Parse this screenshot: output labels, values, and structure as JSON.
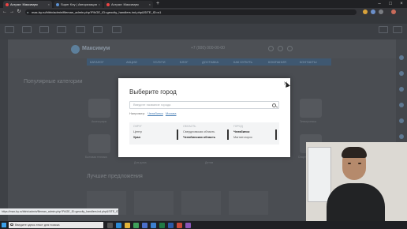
{
  "browser": {
    "tabs": [
      {
        "label": "Астрал: Максимум"
      },
      {
        "label": "Super Key | Авторизация"
      },
      {
        "label": "Астрал: Максимум"
      }
    ],
    "url": "max-by.ru/bitrix/admin/fileman_admin.php?PAGE_ID=geocity_handlers.ind.php&SITE_ID=s1",
    "status_url": "https://max-by.ru/bitrix/admin/fileman_admin.php?PAGE_ID=geocity_handlers.ind.php&SITE_ID=s1#"
  },
  "site": {
    "logo_text": "Максимум",
    "phone": "+7 (000) 000-00-00",
    "menu": [
      "КАТАЛОГ",
      "АКЦИИ",
      "УСЛУГИ",
      "БЛОГ",
      "ДОСТАВКА",
      "КАК КУПИТЬ",
      "КОМПАНИЯ",
      "КОНТАКТЫ"
    ],
    "section_popular": "Популярные категории",
    "section_best": "Лучшие предложения",
    "tiles": [
      "Аксессуары",
      "Электроника",
      "Бытовая техника",
      "Спорт и отдых",
      "Для дома",
      "Детям"
    ]
  },
  "modal": {
    "title": "Выберите город",
    "search_placeholder": "Введите название города",
    "examples_label": "Например:",
    "examples": [
      "Челябинск",
      "Москва"
    ],
    "columns": {
      "region": {
        "header": "ОКРУГ",
        "items": [
          "Центр",
          "Урал"
        ]
      },
      "area": {
        "header": "ОБЛАСТЬ",
        "items": [
          "Свердловская область",
          "Челябинская область"
        ]
      },
      "city": {
        "header": "ГОРОД",
        "items": [
          "Челябинск",
          "Магнитогорск"
        ]
      }
    }
  },
  "taskbar": {
    "search_text": "Введите здесь текст для поиска"
  }
}
